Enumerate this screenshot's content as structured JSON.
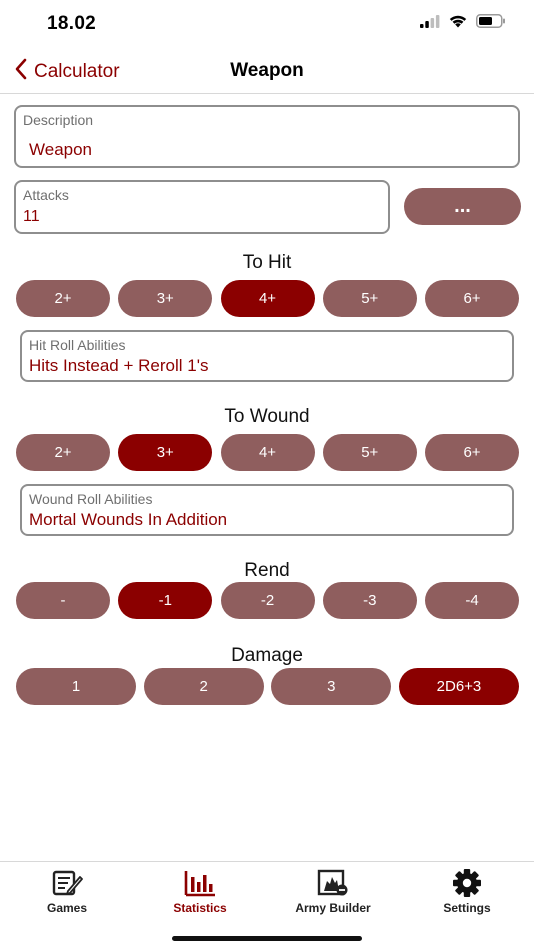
{
  "status": {
    "time": "18.02"
  },
  "nav": {
    "back_label": "Calculator",
    "title": "Weapon"
  },
  "description": {
    "label": "Description",
    "value": "Weapon"
  },
  "attacks": {
    "label": "Attacks",
    "value": "11",
    "more_label": "..."
  },
  "to_hit": {
    "title": "To Hit",
    "options": [
      "2+",
      "3+",
      "4+",
      "5+",
      "6+"
    ],
    "selected": "4+",
    "abilities_label": "Hit Roll Abilities",
    "abilities_value": "Hits Instead + Reroll 1's"
  },
  "to_wound": {
    "title": "To Wound",
    "options": [
      "2+",
      "3+",
      "4+",
      "5+",
      "6+"
    ],
    "selected": "3+",
    "abilities_label": "Wound Roll Abilities",
    "abilities_value": "Mortal Wounds In Addition"
  },
  "rend": {
    "title": "Rend",
    "options": [
      "-",
      "-1",
      "-2",
      "-3",
      "-4"
    ],
    "selected": "-1"
  },
  "damage": {
    "title": "Damage",
    "options": [
      "1",
      "2",
      "3",
      "2D6+3"
    ],
    "selected": "2D6+3"
  },
  "tabs": [
    {
      "label": "Games",
      "icon": "games-icon"
    },
    {
      "label": "Statistics",
      "icon": "statistics-icon",
      "active": true
    },
    {
      "label": "Army Builder",
      "icon": "army-builder-icon"
    },
    {
      "label": "Settings",
      "icon": "settings-gear-icon"
    }
  ],
  "colors": {
    "accent": "#8b0000",
    "pill": "#8f5e5e",
    "border": "#8e8e8e"
  }
}
